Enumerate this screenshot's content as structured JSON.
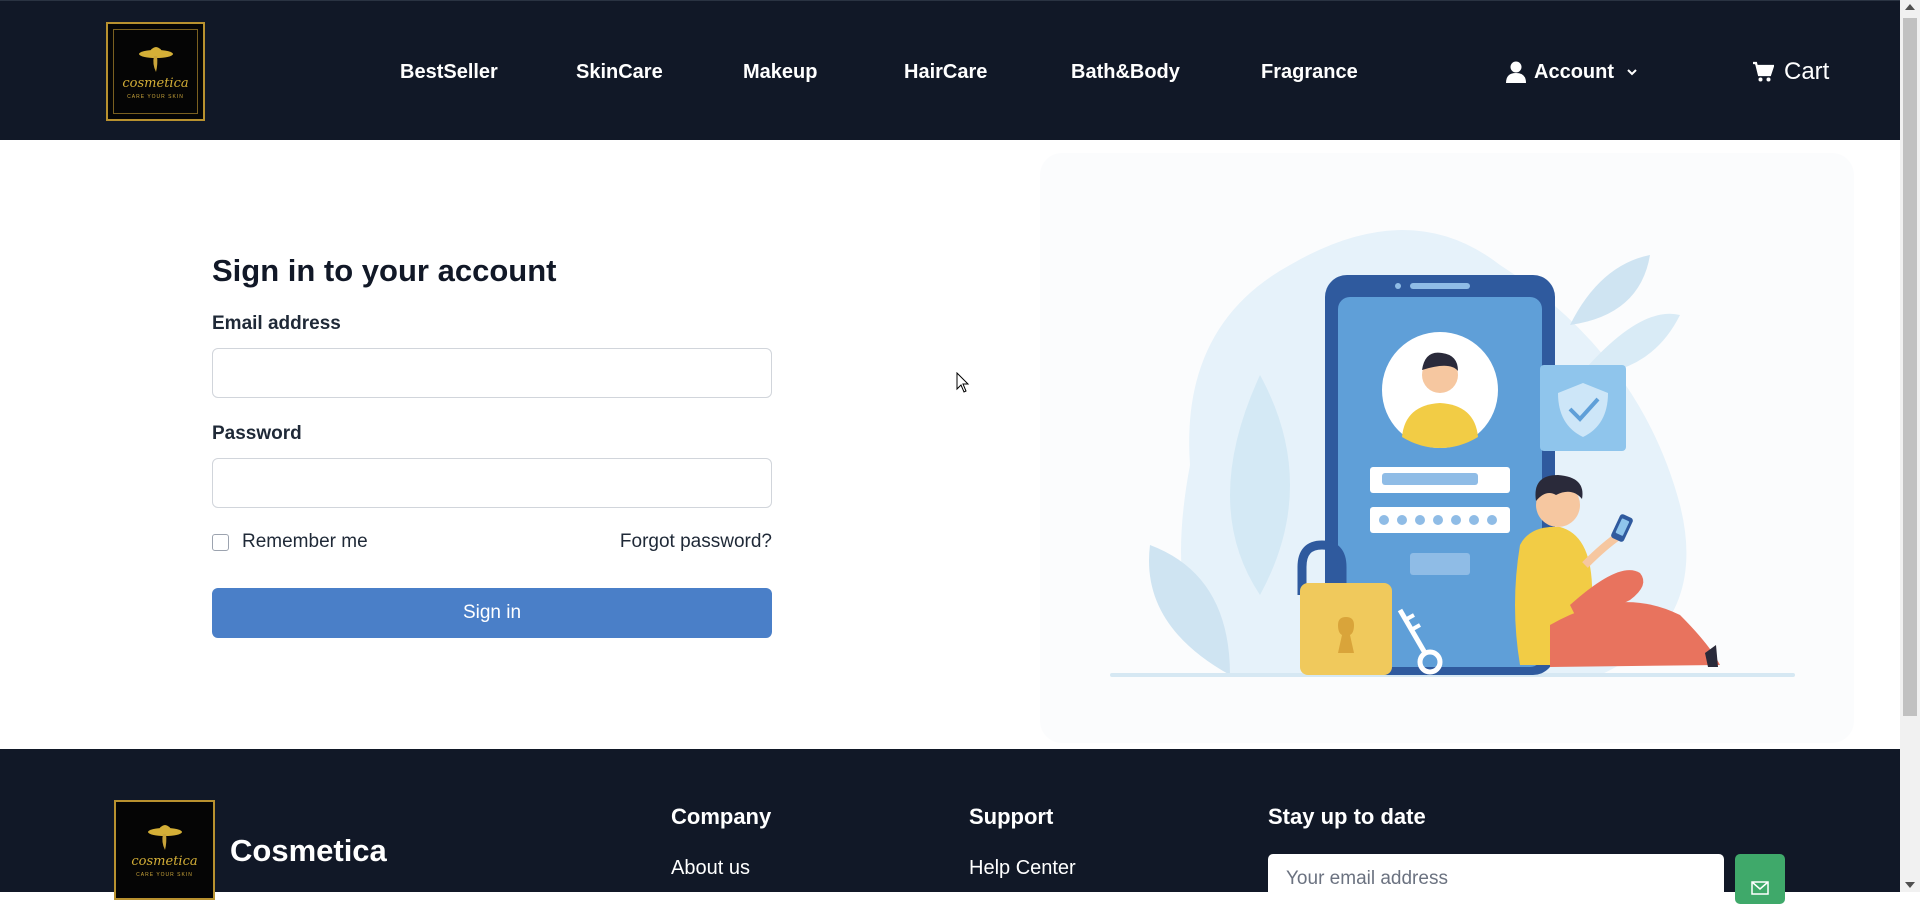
{
  "header": {
    "logo": {
      "word": "cosmetica",
      "tagline": "CARE YOUR SKIN"
    },
    "nav": [
      "BestSeller",
      "SkinCare",
      "Makeup",
      "HairCare",
      "Bath&Body",
      "Fragrance"
    ],
    "account_label": "Account",
    "cart_label": "Cart",
    "icons": {
      "account": "user-icon",
      "account_menu": "chevron-down-icon",
      "cart": "cart-icon"
    }
  },
  "signin": {
    "title": "Sign in to your account",
    "email_label": "Email address",
    "email_value": "",
    "password_label": "Password",
    "password_value": "",
    "remember_label": "Remember me",
    "remember_checked": false,
    "forgot_label": "Forgot password?",
    "submit_label": "Sign in"
  },
  "footer": {
    "brand": "Cosmetica",
    "company_heading": "Company",
    "company_links": [
      "About us"
    ],
    "support_heading": "Support",
    "support_links": [
      "Help Center"
    ],
    "newsletter_heading": "Stay up to date",
    "newsletter_placeholder": "Your email address",
    "newsletter_icon": "send-icon"
  },
  "colors": {
    "header_bg": "#111827",
    "primary_button": "#4a7fc8",
    "newsletter_button": "#3fa96a",
    "logo_gold": "#d4af37"
  }
}
